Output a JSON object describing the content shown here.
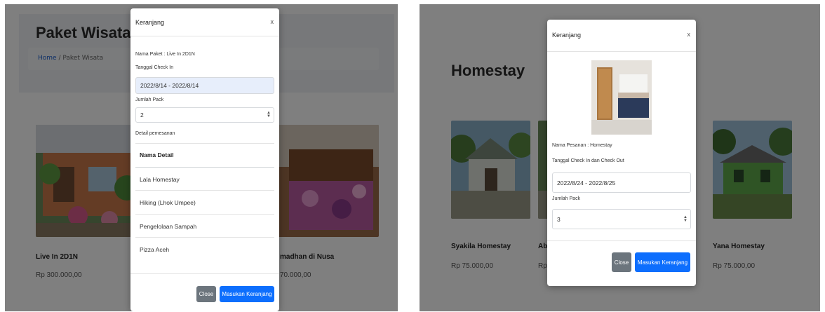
{
  "left": {
    "page_title": "Paket Wisata",
    "breadcrumb": {
      "home": "Home",
      "separator": "/",
      "current": "Paket Wisata"
    },
    "cards": [
      {
        "title": "Live In 2D1N",
        "price": "Rp 300.000,00"
      },
      {
        "title": "madhan di Nusa",
        "price": "70.000,00"
      }
    ],
    "modal": {
      "title": "Keranjang",
      "close_glyph": "x",
      "package_label": "Nama Paket : Live In 2D1N",
      "checkin_label": "Tanggal Check In",
      "checkin_value": "2022/8/14 - 2022/8/14",
      "pack_label": "Jumlah Pack",
      "pack_value": "2",
      "detail_label": "Detail pemesanan",
      "detail_header": "Nama Detail",
      "detail_rows": [
        "Lala Homestay",
        "Hiking (Lhok Umpee)",
        "Pengelolaan Sampah",
        "Pizza Aceh"
      ],
      "close_button": "Close",
      "submit_button": "Masukan Keranjang"
    }
  },
  "right": {
    "page_title": "Homestay",
    "cards": [
      {
        "title": "Syakila Homestay",
        "price": "Rp 75.000,00"
      },
      {
        "title": "Ab",
        "price": "Rp"
      },
      {
        "title": "Yana Homestay",
        "price": "Rp 75.000,00"
      }
    ],
    "modal": {
      "title": "Keranjang",
      "close_glyph": "x",
      "order_label": "Nama Pesanan : Homestay",
      "dates_label": "Tanggal Check In dan Check Out",
      "dates_value": "2022/8/24 - 2022/8/25",
      "pack_label": "Jumlah Pack",
      "pack_value": "3",
      "close_button": "Close",
      "submit_button": "Masukan Keranjang"
    }
  },
  "colors": {
    "primary": "#0d6efd",
    "secondary": "#6c757d",
    "overlay": "rgba(0,0,0,0.5)",
    "highlight": "#e7eefb"
  }
}
